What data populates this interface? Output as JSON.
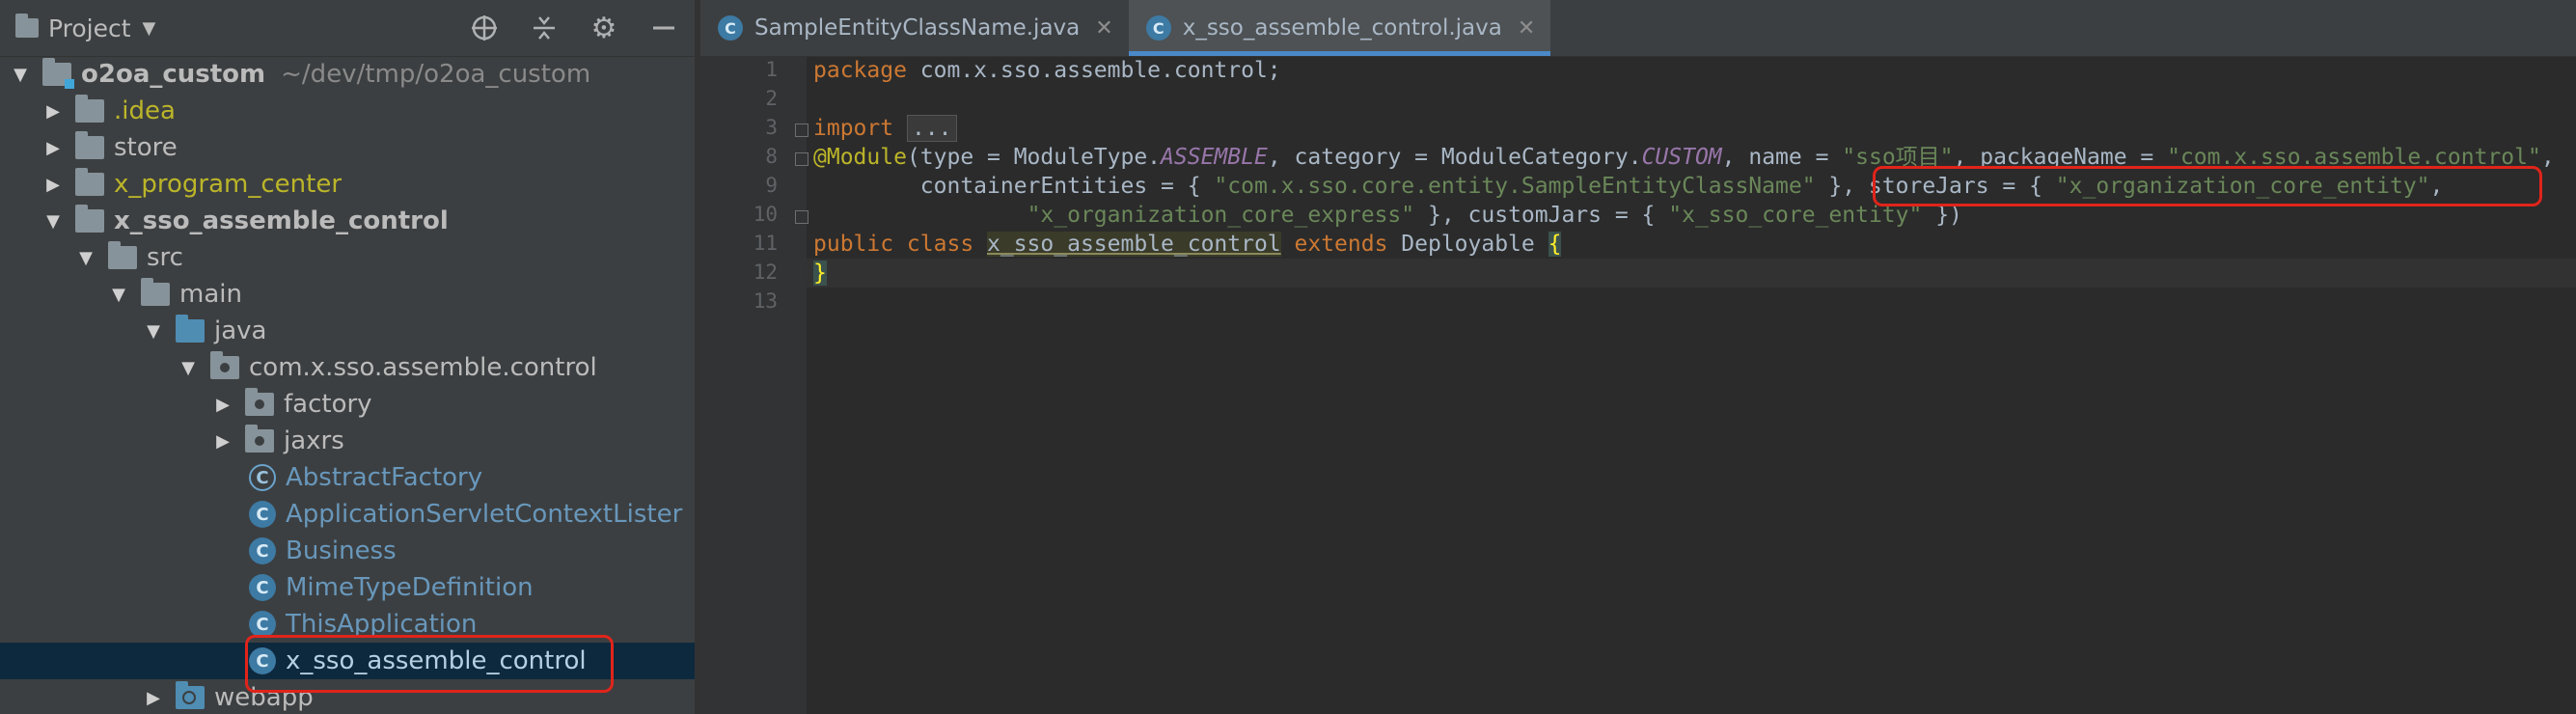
{
  "project_panel": {
    "title": "Project",
    "tree": [
      {
        "label": "o2oa_custom",
        "hint": "~/dev/tmp/o2oa_custom"
      },
      {
        "label": ".idea"
      },
      {
        "label": "store"
      },
      {
        "label": "x_program_center"
      },
      {
        "label": "x_sso_assemble_control"
      },
      {
        "label": "src"
      },
      {
        "label": "main"
      },
      {
        "label": "java"
      },
      {
        "label": "com.x.sso.assemble.control"
      },
      {
        "label": "factory"
      },
      {
        "label": "jaxrs"
      },
      {
        "label": "AbstractFactory"
      },
      {
        "label": "ApplicationServletContextLister"
      },
      {
        "label": "Business"
      },
      {
        "label": "MimeTypeDefinition"
      },
      {
        "label": "ThisApplication"
      },
      {
        "label": "x_sso_assemble_control"
      },
      {
        "label": "webapp"
      }
    ]
  },
  "editor": {
    "tabs": [
      {
        "label": "SampleEntityClassName.java",
        "active": false
      },
      {
        "label": "x_sso_assemble_control.java",
        "active": true
      }
    ],
    "line_numbers": [
      "1",
      "2",
      "3",
      "8",
      "9",
      "10",
      "11",
      "12",
      "13"
    ],
    "code": {
      "l1_kw": "package",
      "l1_rest": " com.x.sso.assemble.control;",
      "l3_kw": "import",
      "l3_dots": "...",
      "l8_ann": "@Module",
      "l8_a": "(type = ModuleType.",
      "l8_b": "ASSEMBLE",
      "l8_c": ", category = ModuleCategory.",
      "l8_d": "CUSTOM",
      "l8_e": ", name = ",
      "l8_f": "\"sso项目\"",
      "l8_g": ", packageName = ",
      "l8_h": "\"com.x.sso.assemble.control\"",
      "l8_i": ",",
      "l9_a": "        containerEntities = { ",
      "l9_b": "\"com.x.sso.core.entity.SampleEntityClassName\"",
      "l9_c": " }, storeJars = { ",
      "l9_d": "\"x_organization_core_entity\"",
      "l9_e": ",",
      "l10_a": "                ",
      "l10_b": "\"x_organization_core_express\"",
      "l10_c": " }, customJars = { ",
      "l10_d": "\"x_sso_core_entity\"",
      "l10_e": " })",
      "l11_kw1": "public class ",
      "l11_name": "x_sso_assemble_control",
      "l11_kw2": " extends ",
      "l11_rest": "Deployable ",
      "l11_brace": "{",
      "l12_brace": "}"
    }
  },
  "colors": {
    "highlight_box": "#e0241b",
    "selection": "#0d293e",
    "tab_underline": "#4a88c7"
  }
}
